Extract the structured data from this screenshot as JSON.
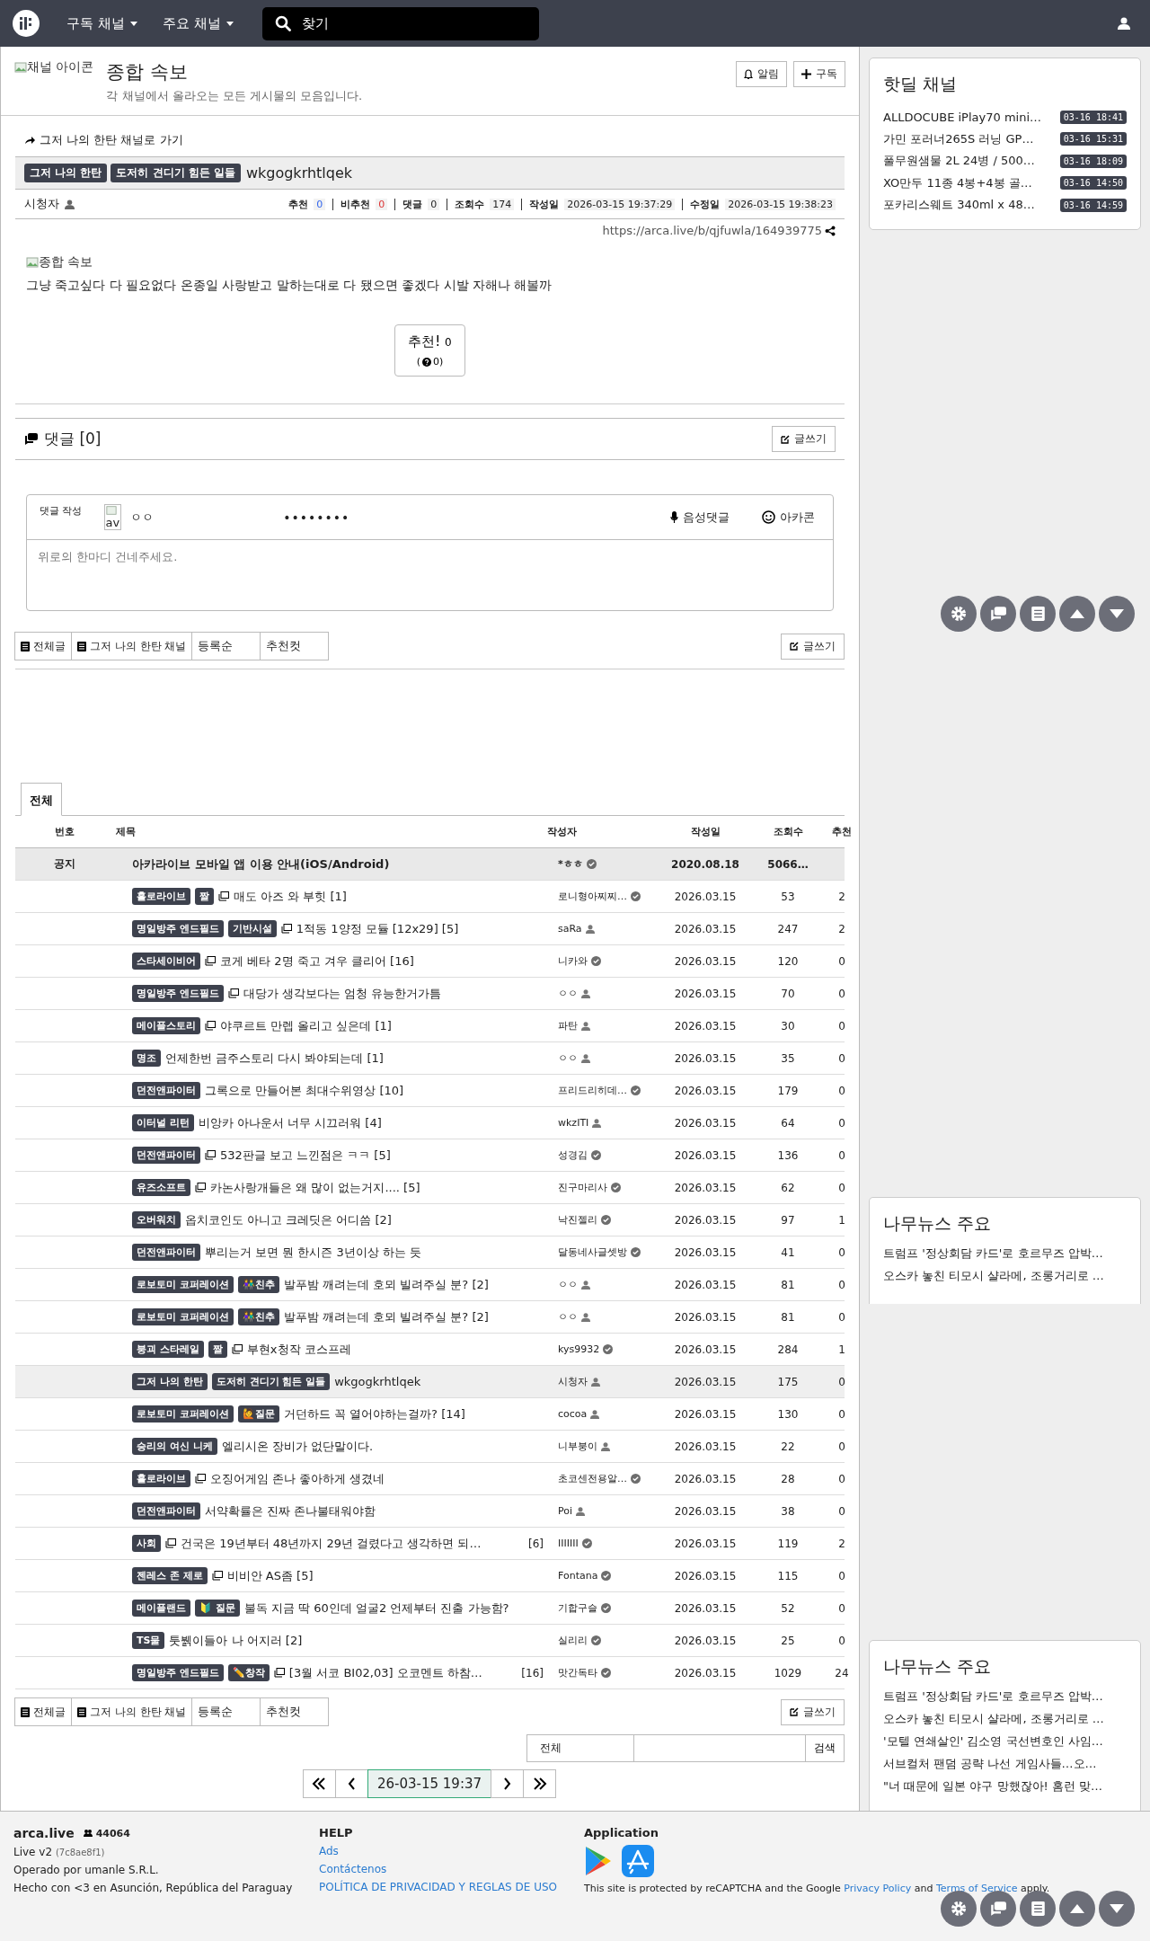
{
  "navbar": {
    "menus": [
      "구독 채널",
      "주요 채널"
    ],
    "search": {
      "placeholder": "찾기"
    }
  },
  "channel": {
    "icon_alt": "채널 아이콘",
    "title": "종합 속보",
    "description": "각 채널에서 올라오는 모든 게시물의 모음입니다.",
    "buttons": [
      "알림",
      "구독"
    ]
  },
  "post": {
    "back_link": "그저 나의 한탄 채널로 가기",
    "badges": [
      "그저 나의 한탄",
      "도저히 견디기 힘든 일들"
    ],
    "title": "wkgogkrhtlqek",
    "author": "시청자",
    "stats": [
      {
        "label": "추천",
        "value": "0",
        "kind": "up"
      },
      {
        "label": "비추천",
        "value": "0",
        "kind": "down"
      },
      {
        "label": "댓글",
        "value": "0",
        "kind": "plain"
      },
      {
        "label": "조회수",
        "value": "174",
        "kind": "plain"
      },
      {
        "label": "작성일",
        "value": "2026-03-15 19:37:29",
        "kind": "plain"
      },
      {
        "label": "수정일",
        "value": "2026-03-15 19:38:23",
        "kind": "plain"
      }
    ],
    "url": "https://arca.live/b/qjfuwla/164939775",
    "image_alt": "종합 속보",
    "body": "그냥 죽고싶다 다 필요없다 온종일 사랑받고 말하는대로 다 됐으면 좋겠다 시발 자해나 해볼까",
    "vote_label": "추천!",
    "vote_count": "0",
    "vote_sub_open": "(",
    "vote_sub": "0)"
  },
  "comments": {
    "title": "댓글 [0]",
    "write_button": "글쓰기",
    "form": {
      "label": "댓글 작성",
      "avatar_alt": "av",
      "name": "ㅇㅇ",
      "password": "••••••••",
      "voice": "음성댓글",
      "emoticon": "아카콘",
      "placeholder": "위로의 한마디 건네주세요."
    }
  },
  "list_toolbars": [
    {
      "buttons": [
        "전체글",
        "그저 나의 한탄 채널",
        "등록순",
        "추천컷"
      ],
      "write_button": "글쓰기"
    },
    {
      "buttons": [
        "전체글",
        "그저 나의 한탄 채널",
        "등록순",
        "추천컷"
      ],
      "write_button": "글쓰기"
    }
  ],
  "tabs": [
    {
      "label": "전체",
      "selected": true
    }
  ],
  "table": {
    "columns": [
      "번호",
      "제목",
      "작성자",
      "작성일",
      "조회수",
      "추천"
    ],
    "rows": [
      {
        "kind": "notice",
        "number": "공지",
        "badges": [],
        "image": false,
        "title": "아카라이브 모바일 앱 이용 안내(iOS/Android)",
        "author": "*ㅎㅎ",
        "verified": true,
        "date": "2020.08.18",
        "views": "5066…",
        "selected": false
      },
      {
        "kind": "post",
        "badges": [
          "홀로라이브",
          "짤"
        ],
        "image": true,
        "title": "매도 아즈 와 부힛 [1]",
        "author": "로니형아찌찌…",
        "verified": true,
        "date": "2026.03.15",
        "views": "53",
        "votes": "2",
        "selected": false
      },
      {
        "kind": "post",
        "badges": [
          "명일방주 엔드필드",
          "기반시설"
        ],
        "image": true,
        "title": "1적동 1양정 모듈 [12x29] [5]",
        "author": "saRa",
        "verified": false,
        "date": "2026.03.15",
        "views": "247",
        "votes": "2",
        "selected": false
      },
      {
        "kind": "post",
        "badges": [
          "스타세이비어"
        ],
        "image": true,
        "title": "코게 베타 2명 죽고 겨우 클리어 [16]",
        "author": "니카와",
        "verified": true,
        "date": "2026.03.15",
        "views": "120",
        "votes": "0",
        "selected": false
      },
      {
        "kind": "post",
        "badges": [
          "명일방주 엔드필드"
        ],
        "image": true,
        "title": "대당가 생각보다는 엄청 유능한거가틈",
        "author": "ㅇㅇ",
        "verified": false,
        "date": "2026.03.15",
        "views": "70",
        "votes": "0",
        "selected": false
      },
      {
        "kind": "post",
        "badges": [
          "메이플스토리"
        ],
        "image": true,
        "title": "야쿠르트 만렙 올리고 싶은데 [1]",
        "author": "파탄",
        "verified": false,
        "date": "2026.03.15",
        "views": "30",
        "votes": "0",
        "selected": false
      },
      {
        "kind": "post",
        "badges": [
          "명조"
        ],
        "image": false,
        "title": "언제한번 금주스토리 다시 봐야되는데 [1]",
        "author": "ㅇㅇ",
        "verified": false,
        "date": "2026.03.15",
        "views": "35",
        "votes": "0",
        "selected": false
      },
      {
        "kind": "post",
        "badges": [
          "던전앤파이터"
        ],
        "image": false,
        "title": "그록으로 만들어본 최대수위영상 [10]",
        "author": "프리드리히데…",
        "verified": true,
        "date": "2026.03.15",
        "views": "179",
        "votes": "0",
        "selected": false
      },
      {
        "kind": "post",
        "badges": [
          "이터널 리턴"
        ],
        "image": false,
        "title": "비앙카 아나운서 너무 시끄러워 [4]",
        "author": "wkzITI",
        "verified": false,
        "date": "2026.03.15",
        "views": "64",
        "votes": "0",
        "selected": false
      },
      {
        "kind": "post",
        "badges": [
          "던전앤파이터"
        ],
        "image": true,
        "title": "532판글 보고 느낀점은 ㅋㅋ [5]",
        "author": "성경김",
        "verified": true,
        "date": "2026.03.15",
        "views": "136",
        "votes": "0",
        "selected": false
      },
      {
        "kind": "post",
        "badges": [
          "유즈소프트"
        ],
        "image": true,
        "title": "카논사랑개들은 왜 많이 없는거지.... [5]",
        "author": "진구마리사",
        "verified": true,
        "date": "2026.03.15",
        "views": "62",
        "votes": "0",
        "selected": false
      },
      {
        "kind": "post",
        "badges": [
          "오버워치"
        ],
        "image": false,
        "title": "옵치코인도 아니고 크레딧은 어디씀 [2]",
        "author": "낙진젤리",
        "verified": true,
        "date": "2026.03.15",
        "views": "97",
        "votes": "1",
        "selected": false
      },
      {
        "kind": "post",
        "badges": [
          "던전앤파이터"
        ],
        "image": false,
        "title": "뿌리는거 보면 뭔 한시즌 3년이상 하는 듯",
        "author": "달동네사글셋방",
        "verified": true,
        "date": "2026.03.15",
        "views": "41",
        "votes": "0",
        "selected": false
      },
      {
        "kind": "post",
        "badges": [
          "로보토미 코퍼레이션",
          "👫친추"
        ],
        "image": false,
        "title": "발푸밤 깨려는데 호뫼 빌려주실 분? [2]",
        "author": "ㅇㅇ",
        "verified": false,
        "date": "2026.03.15",
        "views": "81",
        "votes": "0",
        "selected": false
      },
      {
        "kind": "post",
        "badges": [
          "로보토미 코퍼레이션",
          "👫친추"
        ],
        "image": false,
        "title": "발푸밤 깨려는데 호뫼 빌려주실 분? [2]",
        "author": "ㅇㅇ",
        "verified": false,
        "date": "2026.03.15",
        "views": "81",
        "votes": "0",
        "selected": false
      },
      {
        "kind": "post",
        "badges": [
          "붕괴 스타레일",
          "짤"
        ],
        "image": true,
        "title": "부현x청작 코스프레",
        "author": "kys9932",
        "verified": true,
        "date": "2026.03.15",
        "views": "284",
        "votes": "1",
        "selected": false
      },
      {
        "kind": "post",
        "badges": [
          "그저 나의 한탄",
          "도저히 견디기 힘든 일들"
        ],
        "image": false,
        "title": "wkgogkrhtlqek",
        "author": "시청자",
        "verified": false,
        "date": "2026.03.15",
        "views": "175",
        "votes": "0",
        "selected": true
      },
      {
        "kind": "post",
        "badges": [
          "로보토미 코퍼레이션",
          "🙋질문"
        ],
        "image": false,
        "title": "거던하드 꼭 열어야하는걸까? [14]",
        "author": "cocoa",
        "verified": false,
        "date": "2026.03.15",
        "views": "130",
        "votes": "0",
        "selected": false
      },
      {
        "kind": "post",
        "badges": [
          "승리의 여신 니케"
        ],
        "image": false,
        "title": "엘리시온 장비가 없단말이다.",
        "author": "니부붕이",
        "verified": false,
        "date": "2026.03.15",
        "views": "22",
        "votes": "0",
        "selected": false
      },
      {
        "kind": "post",
        "badges": [
          "홀로라이브"
        ],
        "image": true,
        "title": "오징어게임 존나 좋아하게 생겼네",
        "author": "초코센전용알…",
        "verified": true,
        "date": "2026.03.15",
        "views": "28",
        "votes": "0",
        "selected": false
      },
      {
        "kind": "post",
        "badges": [
          "던전앤파이터"
        ],
        "image": false,
        "title": "서약확률은 진짜 존나불태워야함",
        "author": "Poi",
        "verified": false,
        "date": "2026.03.15",
        "views": "38",
        "votes": "0",
        "selected": false
      },
      {
        "kind": "post",
        "badges": [
          "사회"
        ],
        "image": true,
        "title": "건국은 19년부터 48년까지 29년 걸렸다고 생각하면 되…",
        "comments": "[6]",
        "author": "IIIIIII",
        "verified": true,
        "date": "2026.03.15",
        "views": "119",
        "votes": "2",
        "selected": false
      },
      {
        "kind": "post",
        "badges": [
          "젠레스 존 제로"
        ],
        "image": true,
        "title": "비비안 AS좀 [5]",
        "author": "Fontana",
        "verified": true,
        "date": "2026.03.15",
        "views": "115",
        "votes": "0",
        "selected": false
      },
      {
        "kind": "post",
        "badges": [
          "메이플랜드",
          "🔰 질문"
        ],
        "image": false,
        "title": "불독 지금 딱 60인데 얼굴2 언제부터 진출 가능함?",
        "author": "기합구슬",
        "verified": true,
        "date": "2026.03.15",
        "views": "52",
        "votes": "0",
        "selected": false
      },
      {
        "kind": "post",
        "badges": [
          "TS물"
        ],
        "image": false,
        "title": "툿뷁이들아 나 어지러 [2]",
        "author": "실리리",
        "verified": true,
        "date": "2026.03.15",
        "views": "25",
        "votes": "0",
        "selected": false
      },
      {
        "kind": "post",
        "badges": [
          "명일방주 엔드필드",
          "✏️창작"
        ],
        "image": true,
        "title": "[3월 서코 BI02,03] 오코멘트 하참…",
        "comments": "[16]",
        "author": "맛간독타",
        "verified": true,
        "date": "2026.03.15",
        "views": "1029",
        "votes": "24",
        "selected": false
      }
    ]
  },
  "search": {
    "scope": "전체",
    "button": "검색"
  },
  "pagination": {
    "current": "26-03-15 19:37"
  },
  "sidebar": {
    "hotdeal": {
      "title": "핫딜 채널",
      "items": [
        {
          "title": "ALLDOCUBE iPlay70 mini…",
          "time": "03-16 18:41"
        },
        {
          "title": "가민 포러너265S 러닝 GP…",
          "time": "03-16 15:31"
        },
        {
          "title": "풀무원샘물 2L 24병 / 500…",
          "time": "03-16 18:09"
        },
        {
          "title": "XO만두 11종 4봉+4봉 골…",
          "time": "03-16 14:50"
        },
        {
          "title": "포카리스웨트 340ml x 48…",
          "time": "03-16 14:59"
        }
      ]
    },
    "news": [
      {
        "title": "나무뉴스 주요",
        "items": [
          "트럼프 '정상회담 카드'로 호르무즈 압박…",
          "오스카 놓친 티모시 샬라메, 조롱거리로 …"
        ]
      },
      {
        "title": "나무뉴스 주요",
        "items": [
          "트럼프 '정상회담 카드'로 호르무즈 압박…",
          "오스카 놓친 티모시 샬라메, 조롱거리로 …",
          "'모텔 연쇄살인' 김소영 국선변호인 사임…",
          "서브컬처 팬덤 공략 나선 게임사들…오…",
          "\"너 때문에 일본 야구 망했잖아! 홈런 맞…"
        ]
      }
    ]
  },
  "footer": {
    "site": "arca.live",
    "users": "44064",
    "version": "Live v2",
    "build": "(7c8ae8f1)",
    "operator": "Operado por umanle S.R.L.",
    "made": "Hecho con <3 en Asunción, República del Paraguay",
    "help_title": "HELP",
    "help_links": [
      "Ads",
      "Contáctenos",
      "POLÍTICA DE PRIVACIDAD Y REGLAS DE USO"
    ],
    "app_title": "Application",
    "recaptcha": {
      "before": "This site is protected by reCAPTCHA and the Google",
      "privacy": "Privacy Policy",
      "and": "and",
      "terms": "Terms of Service",
      "after": "apply."
    }
  }
}
